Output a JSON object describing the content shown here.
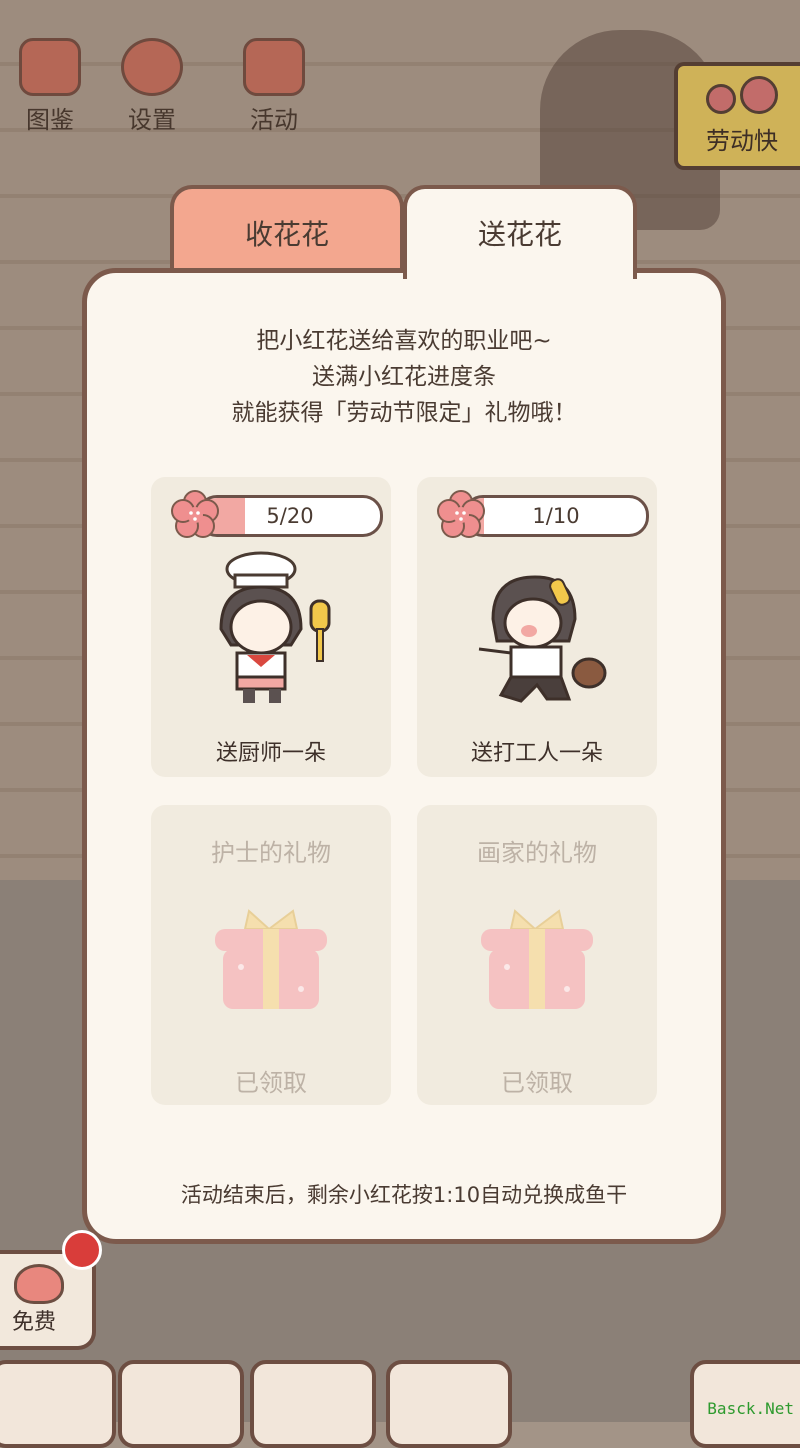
{
  "top_menu": {
    "items": [
      {
        "label": "图鉴",
        "icon": "cat-book-icon"
      },
      {
        "label": "设置",
        "icon": "gear-icon"
      },
      {
        "label": "活动",
        "icon": "gift-icon"
      }
    ]
  },
  "event_banner": {
    "label": "劳动快"
  },
  "tabs": {
    "receive": "收花花",
    "send": "送花花",
    "active": "send"
  },
  "intro": {
    "line1": "把小红花送给喜欢的职业吧~",
    "line2": "送满小红花进度条",
    "line3": "就能获得「劳动节限定」礼物哦！"
  },
  "send_cards": [
    {
      "progress_text": "5/20",
      "progress": 0.25,
      "caption": "送厨师一朵",
      "avatar": "chef-character-icon"
    },
    {
      "progress_text": "1/10",
      "progress": 0.1,
      "caption": "送打工人一朵",
      "avatar": "worker-character-icon"
    }
  ],
  "gift_cards": [
    {
      "title": "护士的礼物",
      "status": "已领取"
    },
    {
      "title": "画家的礼物",
      "status": "已领取"
    }
  ],
  "footer_note": "活动结束后，剩余小红花按1:10自动兑换成鱼干",
  "free_button": {
    "label": "免费"
  },
  "watermark": "Basck.Net",
  "colors": {
    "panel": "#fbf6ee",
    "border": "#7c5a4c",
    "tab_inactive": "#f3a78f",
    "flower": "#ef8f8f",
    "progress_fill": "#f2a8a3"
  }
}
